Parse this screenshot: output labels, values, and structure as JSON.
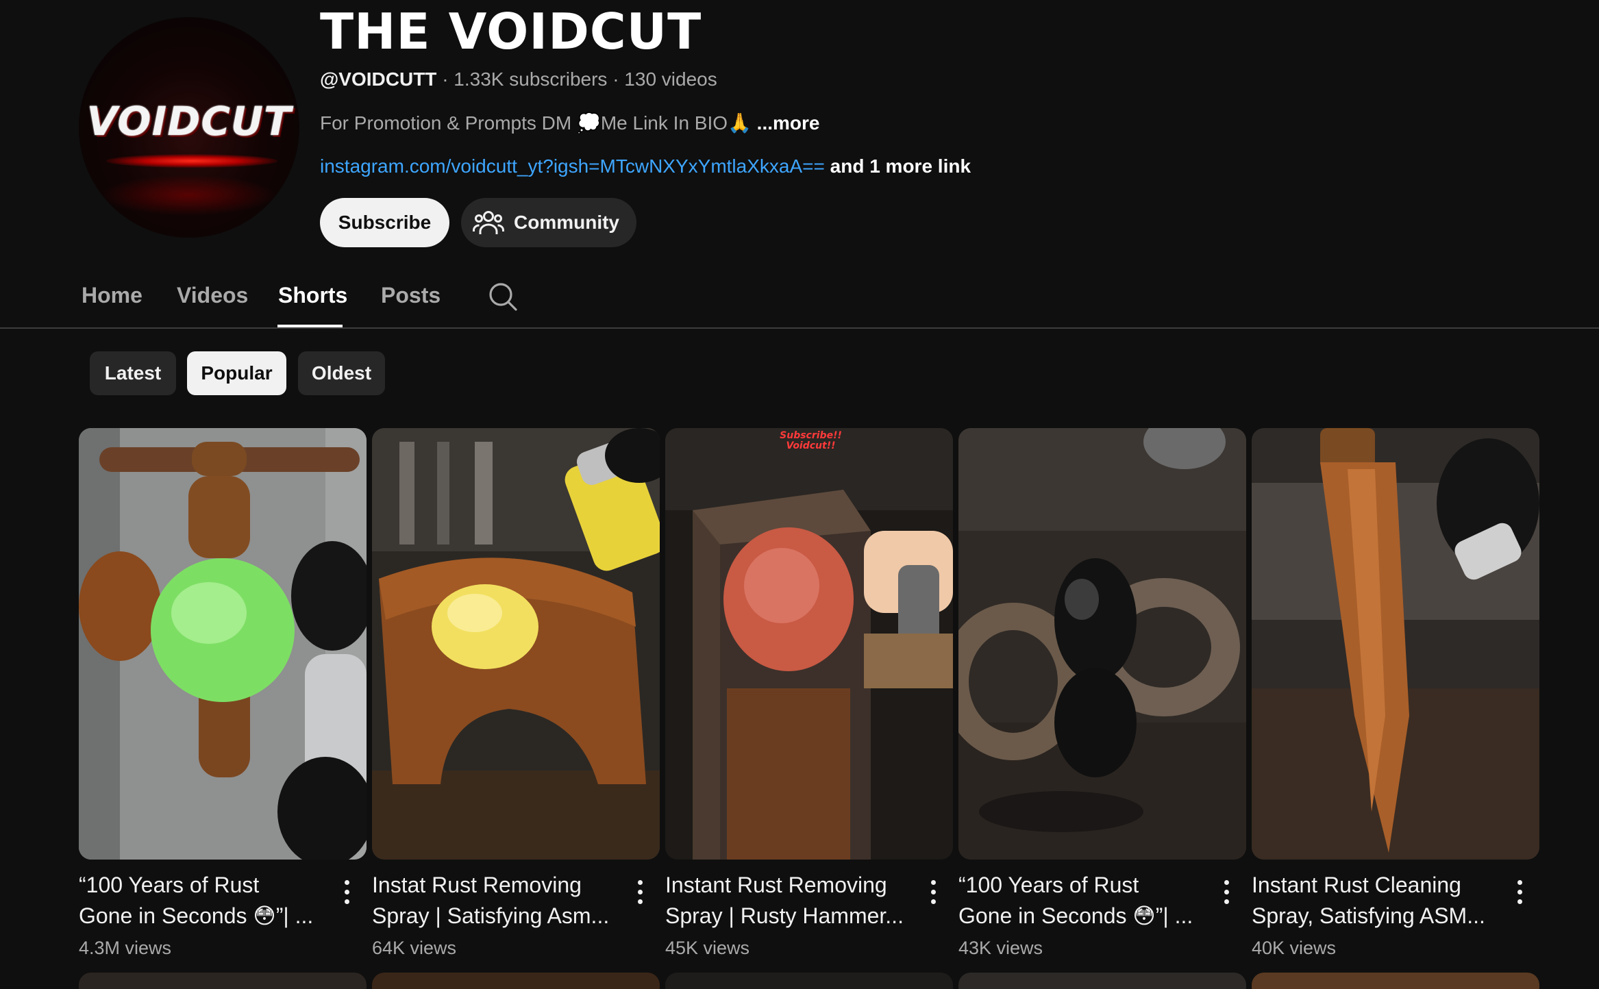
{
  "channel": {
    "avatar_text": "VOIDCUT",
    "title": "THE VOIDCUT",
    "handle": "@VOIDCUTT",
    "subscribers": "1.33K subscribers",
    "videos_count": "130 videos",
    "separator": "·",
    "description": "For Promotion & Prompts DM 💭Me Link In BIO🙏",
    "more_label": "...more",
    "link": "instagram.com/voidcutt_yt?igsh=MTcwNXYxYmtlaXkxaA==",
    "more_links": "and 1 more link",
    "subscribe_label": "Subscribe",
    "community_label": "Community"
  },
  "tabs": [
    {
      "label": "Home",
      "active": false
    },
    {
      "label": "Videos",
      "active": false
    },
    {
      "label": "Shorts",
      "active": true
    },
    {
      "label": "Posts",
      "active": false
    }
  ],
  "sort_chips": [
    {
      "label": "Latest",
      "selected": false
    },
    {
      "label": "Popular",
      "selected": true
    },
    {
      "label": "Oldest",
      "selected": false
    }
  ],
  "shorts": [
    {
      "title_line1": "“100 Years of Rust",
      "title_line2": "Gone in Seconds 😳”| ...",
      "views": "4.3M views"
    },
    {
      "title_line1": "Instat Rust Removing",
      "title_line2": "Spray | Satisfying Asm...",
      "views": "64K views"
    },
    {
      "title_line1": "Instant Rust Removing",
      "title_line2": "Spray | Rusty Hammer...",
      "views": "45K views"
    },
    {
      "title_line1": "“100 Years of Rust",
      "title_line2": "Gone in Seconds 😳”| ...",
      "views": "43K views"
    },
    {
      "title_line1": "Instant Rust Cleaning",
      "title_line2": "Spray, Satisfying ASM...",
      "views": "40K views"
    }
  ],
  "thumb3_overlay": "Subscribe!! Voidcut!!",
  "icons": {
    "community": "people-icon",
    "search": "search-icon",
    "menu": "more-vert-icon"
  }
}
